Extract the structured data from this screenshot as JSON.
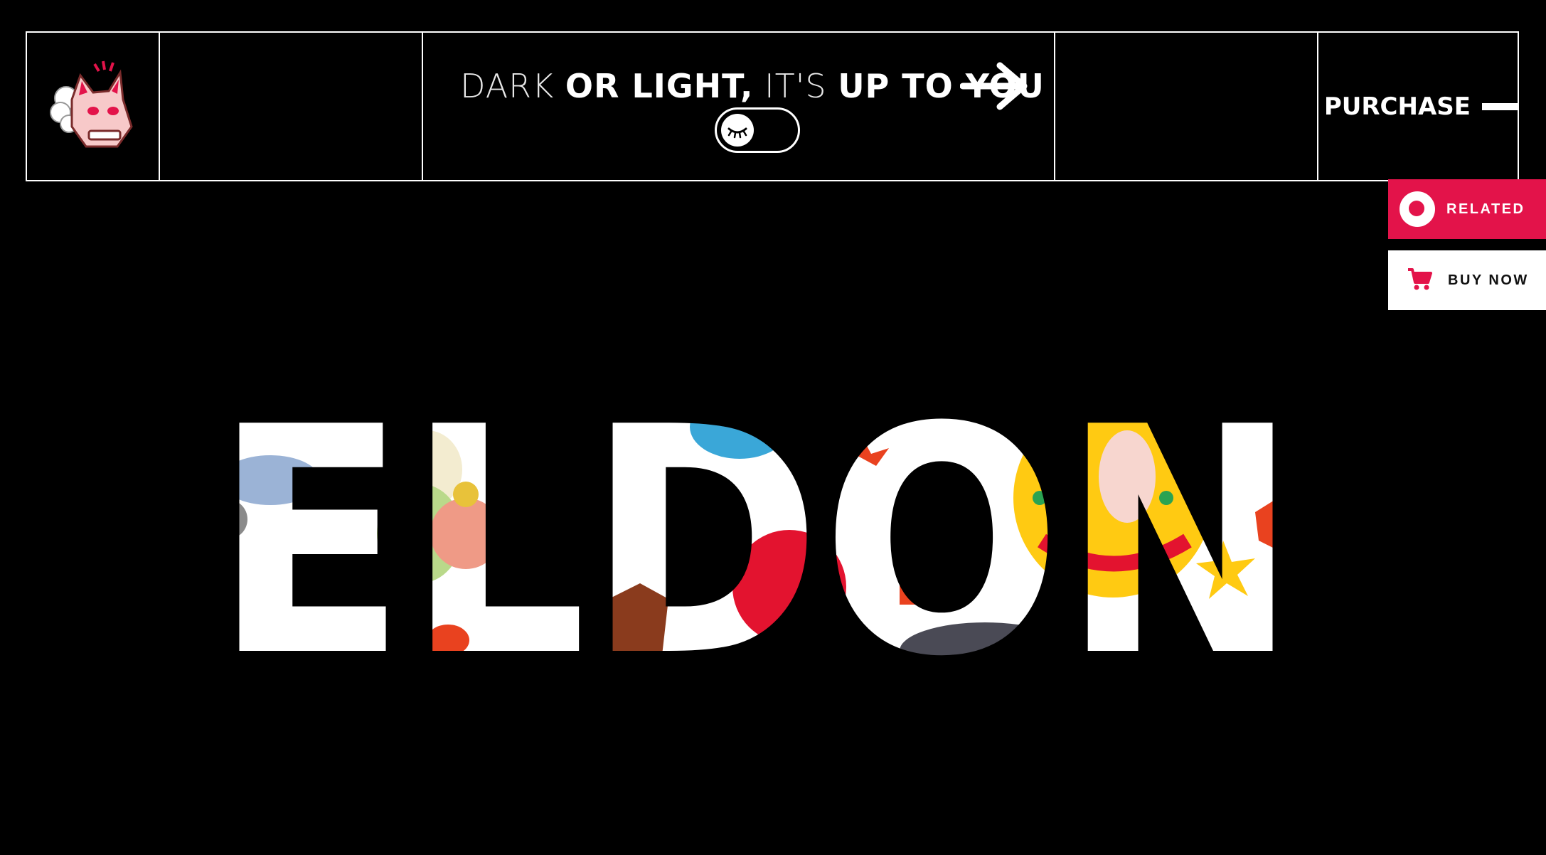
{
  "header": {
    "logo_alt": "Fox mascot logo",
    "tagline": {
      "part1": "DARK",
      "part2": "OR LIGHT,",
      "part3": "IT'S",
      "part4": "UP TO YOU"
    },
    "purchase_label": "PURCHASE"
  },
  "side_buttons": {
    "related_label": "RELATED",
    "buy_label": "BUY NOW"
  },
  "hero": {
    "word": "ELDON"
  },
  "colors": {
    "background": "#000000",
    "accent": "#e3134a",
    "foreground": "#ffffff"
  }
}
